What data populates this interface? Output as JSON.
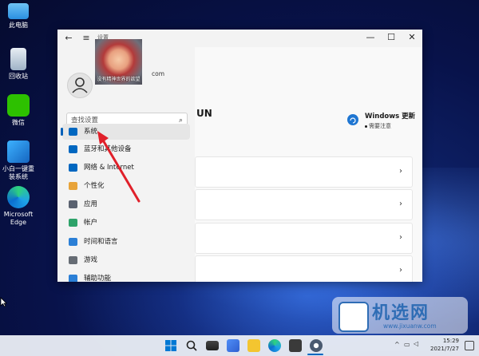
{
  "desktop": {
    "icons": [
      {
        "label": "此电脑"
      },
      {
        "label": "回收站"
      },
      {
        "label": "微信"
      },
      {
        "label": "小白一键重装系统"
      },
      {
        "label": "Microsoft Edge"
      }
    ]
  },
  "window": {
    "title_partial": "设置",
    "profile": {
      "photo_caption": "没有精神世界的欲望",
      "account_tail": "com"
    },
    "search": {
      "placeholder": "查找设置"
    },
    "nav": [
      {
        "label": "系统",
        "icon": "system-icon",
        "color": "#0067c0",
        "selected": true
      },
      {
        "label": "蓝牙和其他设备",
        "icon": "bluetooth-icon",
        "color": "#0067c0"
      },
      {
        "label": "网络 & Internet",
        "icon": "network-icon",
        "color": "#0067c0"
      },
      {
        "label": "个性化",
        "icon": "brush-icon",
        "color": "#e8a33a"
      },
      {
        "label": "应用",
        "icon": "apps-icon",
        "color": "#5a6270"
      },
      {
        "label": "帐户",
        "icon": "account-icon",
        "color": "#2ea36a"
      },
      {
        "label": "时间和语言",
        "icon": "time-language-icon",
        "color": "#2b7fd6"
      },
      {
        "label": "游戏",
        "icon": "gaming-icon",
        "color": "#666c74"
      },
      {
        "label": "辅助功能",
        "icon": "accessibility-icon",
        "color": "#2b7fd6"
      }
    ],
    "main": {
      "heading_partial": "UN",
      "update": {
        "title": "Windows 更新",
        "subtitle": "需要注意"
      }
    }
  },
  "tray": {
    "time": "15:29",
    "date": "2021/7/27"
  },
  "watermark": {
    "text": "机选网",
    "url": "www.jixuanw.com"
  },
  "accent": "#0067c0",
  "annotation_arrow_color": "#e0202a"
}
